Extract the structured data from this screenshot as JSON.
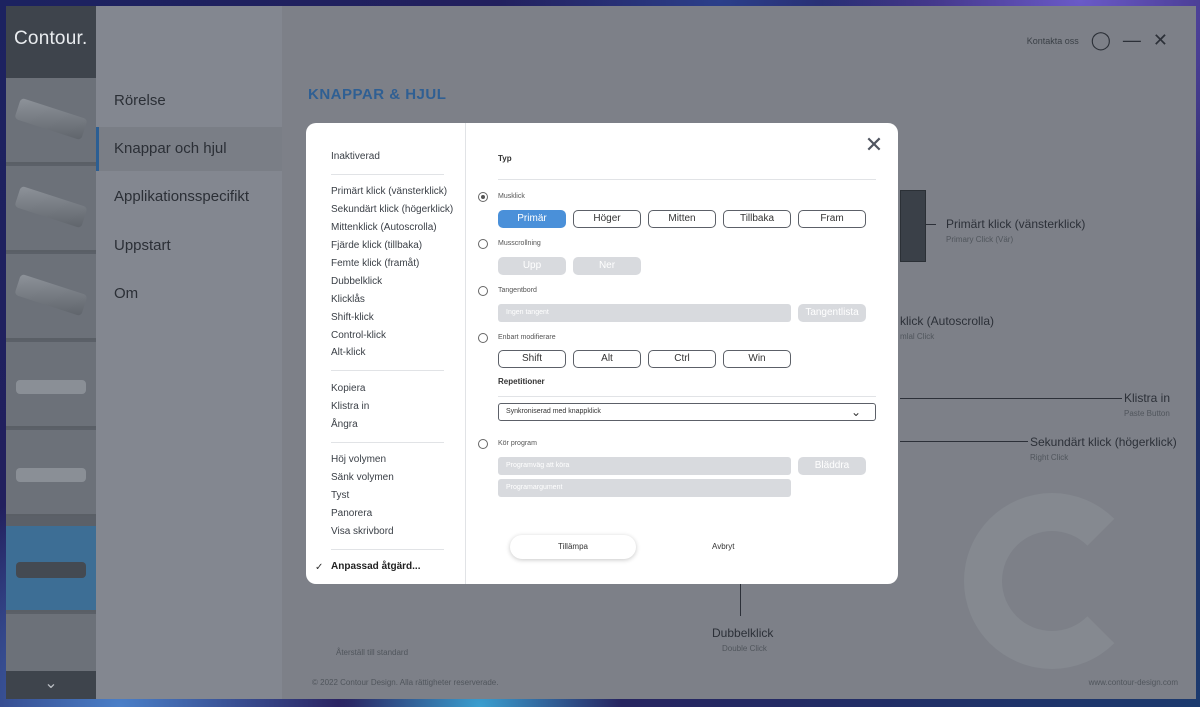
{
  "app": {
    "logo": "Contour.",
    "topbar": {
      "label": "Kontakta oss"
    }
  },
  "nav": {
    "items": [
      {
        "label": "Rörelse"
      },
      {
        "label": "Knappar och hjul"
      },
      {
        "label": "Applikationsspecifikt"
      },
      {
        "label": "Uppstart"
      },
      {
        "label": "Om"
      }
    ]
  },
  "main": {
    "title": "KNAPPAR & HJUL",
    "diagram": {
      "primary": {
        "label": "Primärt klick (vänsterklick)",
        "sub": "Primary Click (Vär)"
      },
      "middle": {
        "label": "klick (Autoscrolla)",
        "sub": "mlal Click"
      },
      "paste": {
        "label": "Klistra in",
        "sub": "Paste Button"
      },
      "secondary": {
        "label": "Sekundärt klick (högerklick)",
        "sub": "Right Click"
      },
      "double": {
        "label": "Dubbelklick",
        "sub": "Double Click"
      }
    },
    "reset": "Återställ till standard",
    "footer_left": "© 2022 Contour Design. Alla rättigheter reserverade.",
    "footer_right": "www.contour-design.com"
  },
  "modal": {
    "actions": {
      "group0": [
        "Inaktiverad"
      ],
      "group1": [
        "Primärt klick (vänsterklick)",
        "Sekundärt klick (högerklick)",
        "Mittenklick (Autoscrolla)",
        "Fjärde klick (tillbaka)",
        "Femte klick (framåt)",
        "Dubbelklick",
        "Klicklås",
        "Shift-klick",
        "Control-klick",
        "Alt-klick"
      ],
      "group2": [
        "Kopiera",
        "Klistra in",
        "Ångra"
      ],
      "group3": [
        "Höj volymen",
        "Sänk volymen",
        "Tyst",
        "Panorera",
        "Visa skrivbord"
      ],
      "selected": "Anpassad åtgärd..."
    },
    "config": {
      "type_title": "Typ",
      "mouse_click": {
        "label": "Musklick",
        "buttons": [
          "Primär",
          "Höger",
          "Mitten",
          "Tillbaka",
          "Fram"
        ]
      },
      "scroll": {
        "label": "Musscrollning",
        "buttons": [
          "Upp",
          "Ner"
        ]
      },
      "keyboard": {
        "label": "Tangentbord",
        "placeholder": "Ingen tangent",
        "button": "Tangentlista"
      },
      "modifiers": {
        "label": "Enbart modifierare",
        "buttons": [
          "Shift",
          "Alt",
          "Ctrl",
          "Win"
        ]
      },
      "repeat_title": "Repetitioner",
      "repeat_value": "Synkroniserad med knappklick",
      "run_program": {
        "label": "Kör program",
        "path_placeholder": "Programväg att köra",
        "args_placeholder": "Programargument",
        "button": "Bläddra"
      },
      "apply": "Tillämpa",
      "cancel": "Avbryt"
    }
  }
}
